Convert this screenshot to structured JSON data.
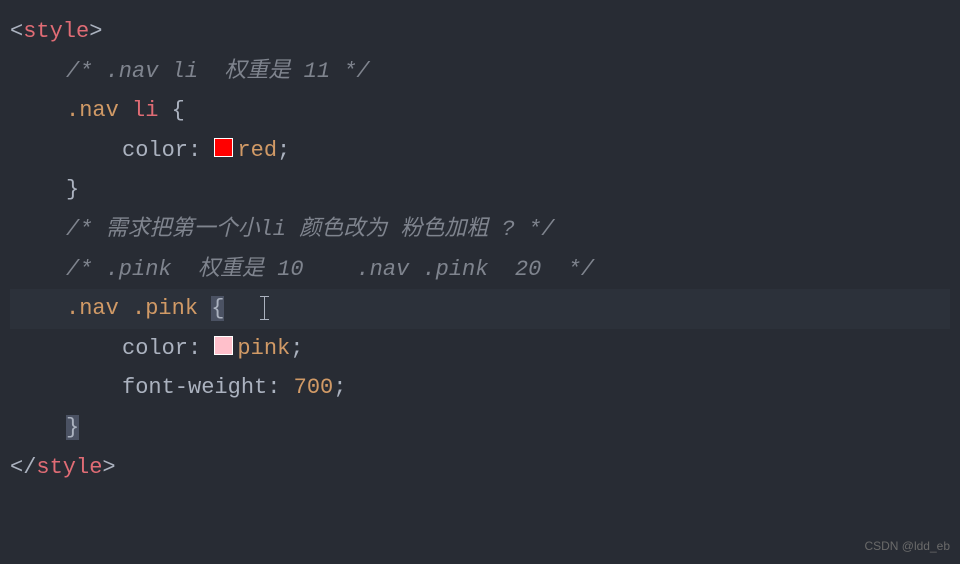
{
  "tags": {
    "openBracket": "<",
    "closeBracket": ">",
    "openSlashBracket": "</",
    "styleTag": "style"
  },
  "code": {
    "comment1": "/* .nav li  权重是 11 */",
    "selector1_class": ".nav",
    "selector1_el": "li",
    "brace_open": "{",
    "brace_close": "}",
    "prop_color": "color",
    "colon_space": ": ",
    "val_red": "red",
    "semicolon": ";",
    "comment2": "/* 需求把第一个小li 颜色改为 粉色加粗 ? */",
    "comment3": "/* .pink  权重是 10    .nav .pink  20  */",
    "selector2_class1": ".nav",
    "selector2_class2": ".pink",
    "val_pink": "pink",
    "prop_fontweight": "font-weight",
    "val_700": "700"
  },
  "colors": {
    "red_swatch": "#ff0000",
    "pink_swatch": "#ffc0cb"
  },
  "watermark": "CSDN @ldd_eb"
}
